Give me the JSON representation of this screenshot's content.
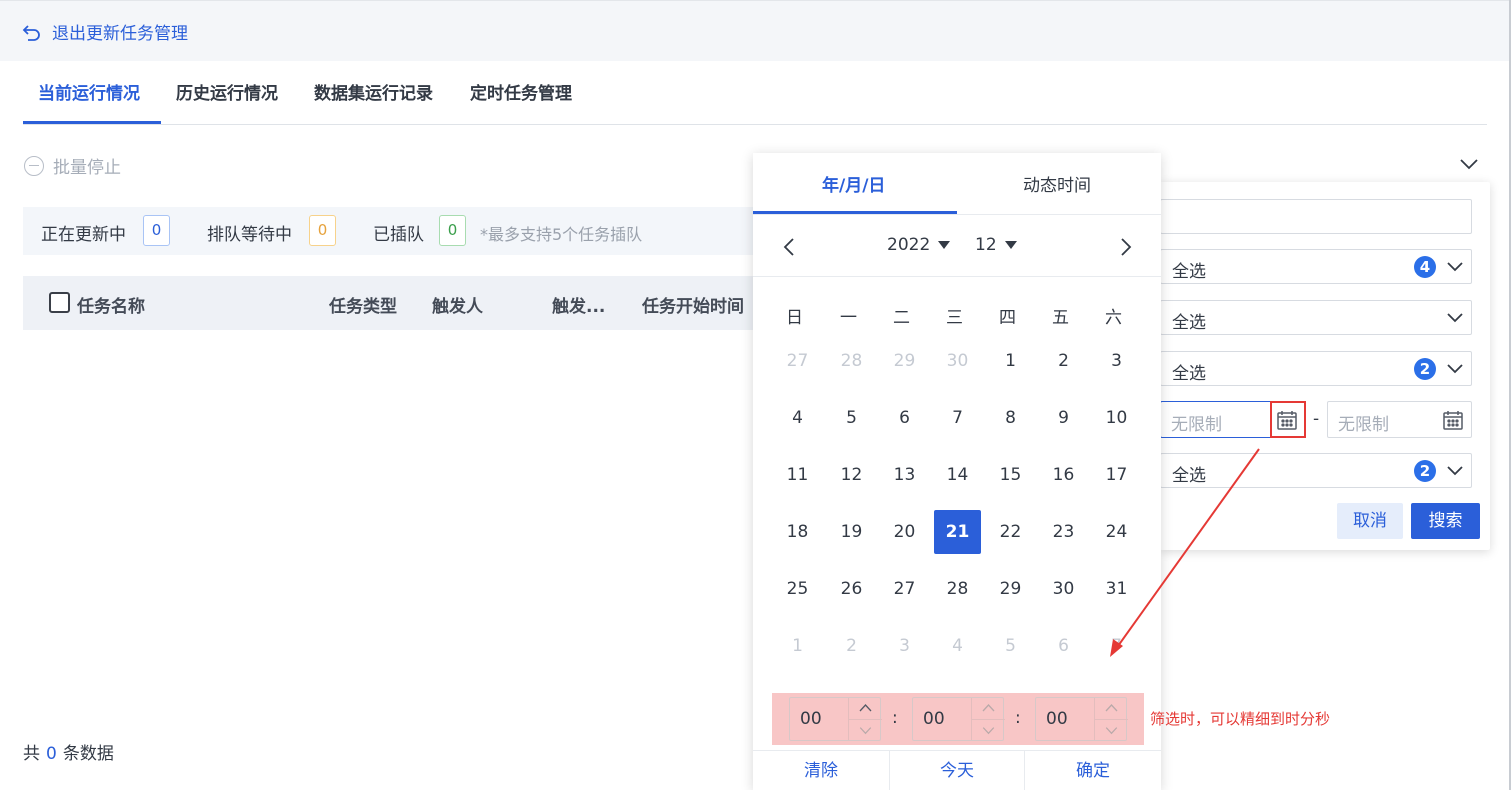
{
  "header": {
    "back_label": "退出更新任务管理"
  },
  "tabs": [
    {
      "label": "当前运行情况",
      "active": true
    },
    {
      "label": "历史运行情况"
    },
    {
      "label": "数据集运行记录"
    },
    {
      "label": "定时任务管理"
    }
  ],
  "toolbar": {
    "batch_stop": "批量停止"
  },
  "status": {
    "updating_label": "正在更新中",
    "updating_count": "0",
    "queued_label": "排队等待中",
    "queued_count": "0",
    "inserted_label": "已插队",
    "inserted_count": "0",
    "note": "*最多支持5个任务插队"
  },
  "table": {
    "columns": [
      "任务名称",
      "任务类型",
      "触发人",
      "触发...",
      "任务开始时间"
    ]
  },
  "footer": {
    "total_prefix": "共",
    "total_count": "0",
    "total_suffix": "条数据"
  },
  "filter": {
    "search_value": "",
    "select1": {
      "value": "全选",
      "badge": "4"
    },
    "select2": {
      "value": "全选"
    },
    "select3": {
      "value": "全选",
      "badge": "2"
    },
    "date_start_placeholder": "无限制",
    "date_sep": "-",
    "date_end_placeholder": "无限制",
    "select4": {
      "value": "全选",
      "badge": "2"
    },
    "cancel": "取消",
    "search": "搜索"
  },
  "datepicker": {
    "tab_date": "年/月/日",
    "tab_dynamic": "动态时间",
    "year": "2022",
    "month": "12",
    "weekdays": [
      "日",
      "一",
      "二",
      "三",
      "四",
      "五",
      "六"
    ],
    "days": [
      [
        "27",
        "28",
        "29",
        "30",
        "1",
        "2",
        "3"
      ],
      [
        "4",
        "5",
        "6",
        "7",
        "8",
        "9",
        "10"
      ],
      [
        "11",
        "12",
        "13",
        "14",
        "15",
        "16",
        "17"
      ],
      [
        "18",
        "19",
        "20",
        "21",
        "22",
        "23",
        "24"
      ],
      [
        "25",
        "26",
        "27",
        "28",
        "29",
        "30",
        "31"
      ],
      [
        "1",
        "2",
        "3",
        "4",
        "5",
        "6",
        "7"
      ]
    ],
    "selected_day": "21",
    "time": {
      "hour": "00",
      "minute": "00",
      "second": "00",
      "sep": ":"
    },
    "clear": "清除",
    "today": "今天",
    "confirm": "确定"
  },
  "annotation": "筛选时，可以精细到时分秒",
  "colors": {
    "accent": "#2b5fd9",
    "annotation": "#e53935",
    "highlight": "#f8c6c6"
  }
}
